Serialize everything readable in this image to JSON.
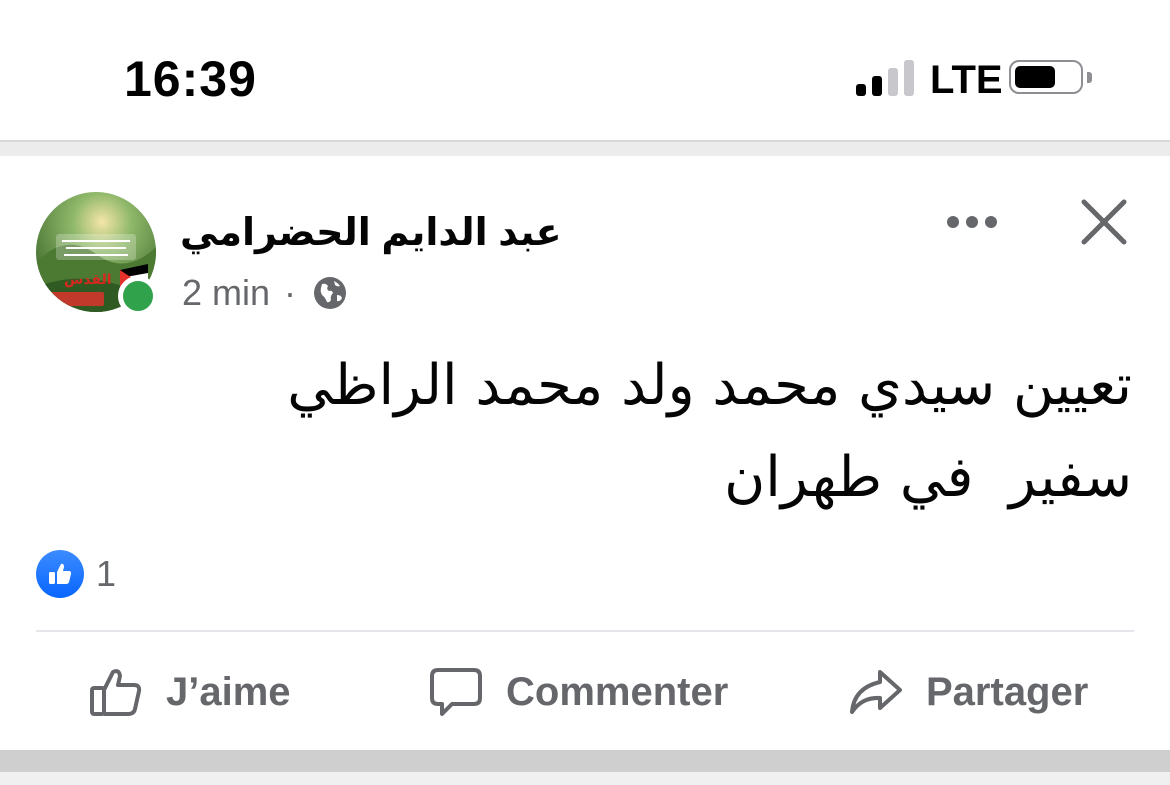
{
  "status_bar": {
    "time": "16:39",
    "network": "LTE",
    "signal_bars_active": 2,
    "signal_bars_total": 4,
    "battery_level": 0.65
  },
  "post": {
    "author": "عبد الدايم الحضرامي",
    "time_ago": "2 min",
    "separator": "·",
    "audience_icon": "globe-icon",
    "text": "تعيين سيدي محمد ولد محمد الراظي\nسفير  في طهران",
    "reaction_icon": "like-icon",
    "reaction_count": "1",
    "online": true
  },
  "actions": {
    "like_label": "J’aime",
    "comment_label": "Commenter",
    "share_label": "Partager"
  },
  "colors": {
    "meta_gray": "#65676b",
    "like_blue": "#0866ff",
    "online_green": "#31a24c"
  }
}
